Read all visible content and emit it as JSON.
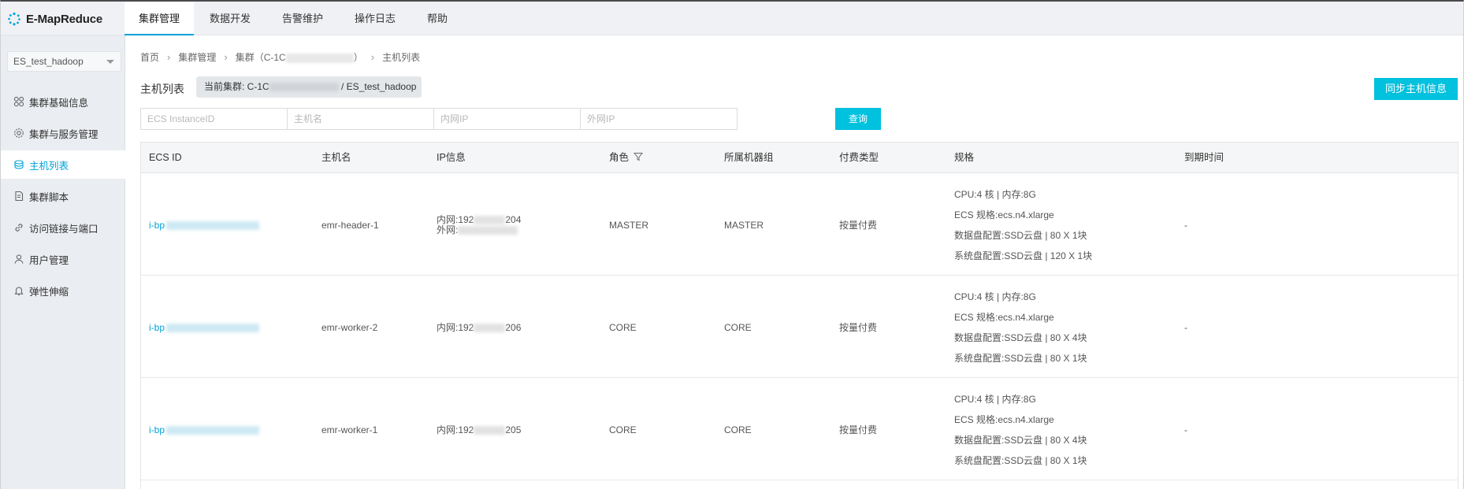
{
  "brand": {
    "name": "E-MapReduce",
    "icon": "emr-logo-icon",
    "accent": "#00a2d9"
  },
  "topnav": [
    {
      "label": "集群管理",
      "active": true
    },
    {
      "label": "数据开发",
      "active": false
    },
    {
      "label": "告警维护",
      "active": false
    },
    {
      "label": "操作日志",
      "active": false
    },
    {
      "label": "帮助",
      "active": false
    }
  ],
  "sidebar": {
    "cluster_select": "ES_test_hadoop",
    "items": [
      {
        "label": "集群基础信息",
        "icon": "grid-icon"
      },
      {
        "label": "集群与服务管理",
        "icon": "gear-icon"
      },
      {
        "label": "主机列表",
        "icon": "hosts-icon",
        "active": true
      },
      {
        "label": "集群脚本",
        "icon": "script-icon"
      },
      {
        "label": "访问链接与端口",
        "icon": "link-icon"
      },
      {
        "label": "用户管理",
        "icon": "user-icon"
      },
      {
        "label": "弹性伸缩",
        "icon": "bell-icon"
      }
    ]
  },
  "breadcrumb": {
    "home": "首页",
    "cluster_mgmt": "集群管理",
    "cluster_prefix": "集群（C-1C",
    "cluster_suffix": "）",
    "current": "主机列表"
  },
  "page": {
    "title": "主机列表",
    "current_cluster_prefix": "当前集群: C-1C",
    "current_cluster_suffix": " / ES_test_hadoop",
    "sync_button": "同步主机信息"
  },
  "filters": {
    "ecs_placeholder": "ECS InstanceID",
    "hostname_placeholder": "主机名",
    "inner_ip_placeholder": "内网IP",
    "outer_ip_placeholder": "外网IP",
    "query_button": "查询"
  },
  "table": {
    "headers": {
      "ecs_id": "ECS ID",
      "hostname": "主机名",
      "ip": "IP信息",
      "role": "角色",
      "group": "所属机器组",
      "billing": "付费类型",
      "spec": "规格",
      "expire": "到期时间"
    },
    "rows": [
      {
        "ecs_prefix": "i-bp",
        "hostname": "emr-header-1",
        "inner_ip_prefix": "内网:192",
        "inner_ip_suffix": "204",
        "outer_ip_prefix": "外网:",
        "role": "MASTER",
        "group": "MASTER",
        "billing": "按量付费",
        "spec": [
          "CPU:4 核 | 内存:8G",
          "ECS 规格:ecs.n4.xlarge",
          "数据盘配置:SSD云盘 | 80 X 1块",
          "系统盘配置:SSD云盘 | 120 X 1块"
        ],
        "expire": "-"
      },
      {
        "ecs_prefix": "i-bp",
        "hostname": "emr-worker-2",
        "inner_ip_prefix": "内网:192",
        "inner_ip_suffix": "206",
        "role": "CORE",
        "group": "CORE",
        "billing": "按量付费",
        "spec": [
          "CPU:4 核 | 内存:8G",
          "ECS 规格:ecs.n4.xlarge",
          "数据盘配置:SSD云盘 | 80 X 4块",
          "系统盘配置:SSD云盘 | 80 X 1块"
        ],
        "expire": "-"
      },
      {
        "ecs_prefix": "i-bp",
        "hostname": "emr-worker-1",
        "inner_ip_prefix": "内网:192",
        "inner_ip_suffix": "205",
        "role": "CORE",
        "group": "CORE",
        "billing": "按量付费",
        "spec": [
          "CPU:4 核 | 内存:8G",
          "ECS 规格:ecs.n4.xlarge",
          "数据盘配置:SSD云盘 | 80 X 4块",
          "系统盘配置:SSD云盘 | 80 X 1块"
        ],
        "expire": "-"
      }
    ]
  }
}
